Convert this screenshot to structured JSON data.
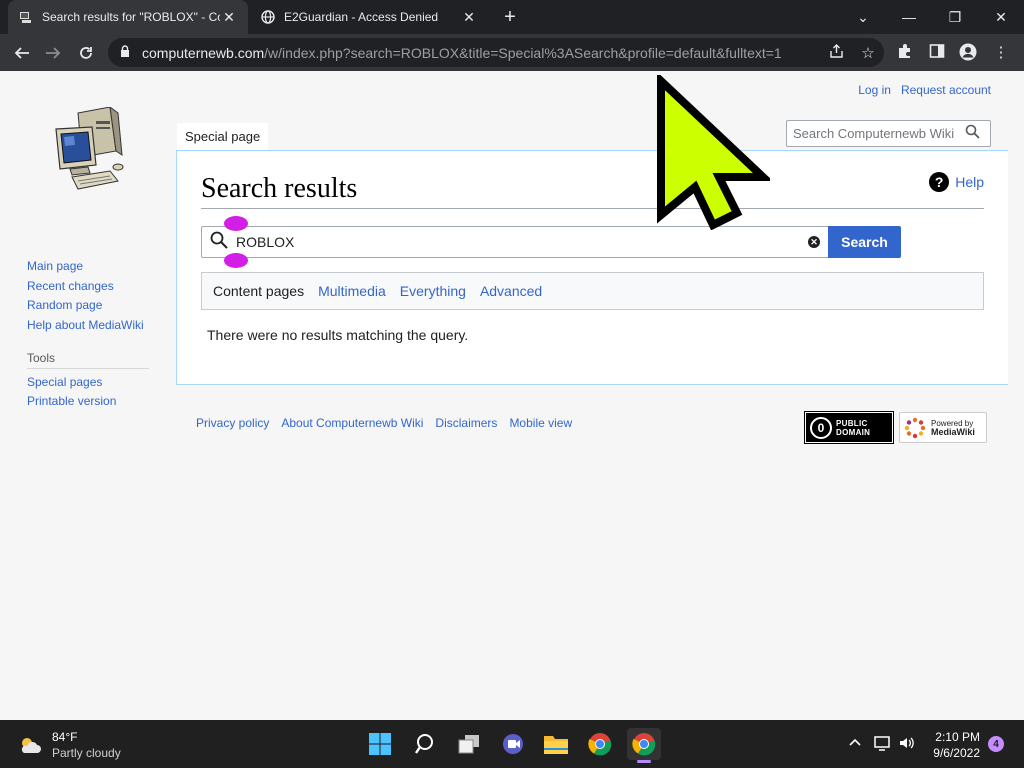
{
  "browser": {
    "tabs": [
      {
        "title": "Search results for \"ROBLOX\" - Co",
        "close": "✕"
      },
      {
        "title": "E2Guardian - Access Denied",
        "close": "✕"
      }
    ],
    "new_tab": "+",
    "url_host": "computernewb.com",
    "url_path": "/w/index.php?search=ROBLOX&title=Special%3ASearch&profile=default&fulltext=1"
  },
  "wiki": {
    "personal": {
      "login": "Log in",
      "request": "Request account"
    },
    "namespace_tab": "Special page",
    "search_placeholder": "Search Computernewb Wiki",
    "heading": "Search results",
    "help": "Help",
    "query": "ROBLOX",
    "search_button": "Search",
    "profiles": {
      "current": "Content pages",
      "links": [
        "Multimedia",
        "Everything",
        "Advanced"
      ]
    },
    "no_results": "There were no results matching the query.",
    "sidebar": [
      "Main page",
      "Recent changes",
      "Random page",
      "Help about MediaWiki"
    ],
    "tools_heading": "Tools",
    "tools": [
      "Special pages",
      "Printable version"
    ],
    "footer": [
      "Privacy policy",
      "About Computernewb Wiki",
      "Disclaimers",
      "Mobile view"
    ],
    "pd_badge": {
      "line1": "PUBLIC",
      "line2": "DOMAIN"
    },
    "mw_badge": {
      "line1": "Powered by",
      "line2": "MediaWiki"
    }
  },
  "taskbar": {
    "temp": "84°F",
    "condition": "Partly cloudy",
    "time": "2:10 PM",
    "date": "9/6/2022",
    "notifications": "4"
  },
  "colors": {
    "link": "#3366cc",
    "accent": "#d21ee6",
    "cursor": "#ccff00"
  }
}
